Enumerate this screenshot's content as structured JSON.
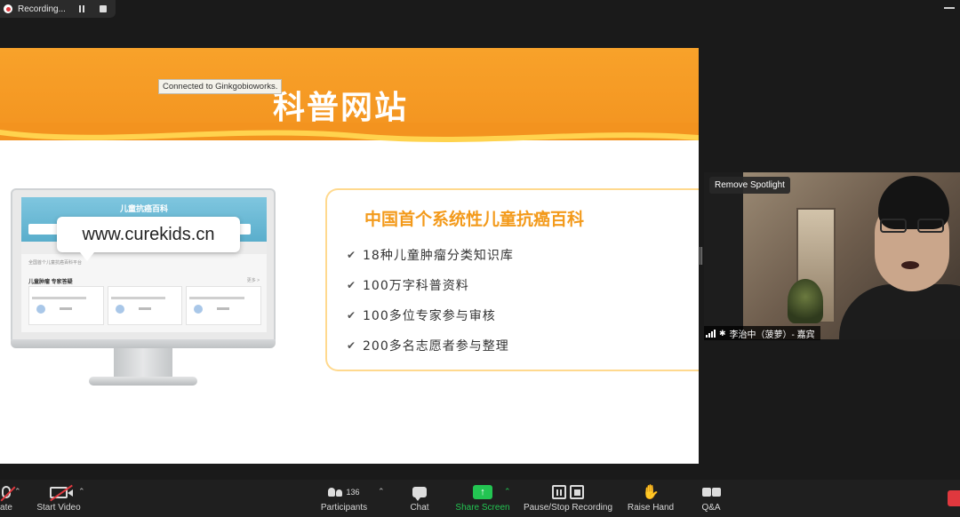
{
  "recording": {
    "label": "Recording..."
  },
  "slide": {
    "title": "科普网站",
    "tooltip": "Connected to Ginkgobioworks.",
    "monitor": {
      "site_title": "儿童抗癌百科",
      "url": "www.curekids.cn",
      "site_sub": "全国首个儿童抗癌百科平台",
      "section_title": "儿童肿瘤 专家答疑",
      "more": "更多 >"
    },
    "feature": {
      "title": "中国首个系统性儿童抗癌百科",
      "items": [
        "18种儿童肿瘤分类知识库",
        "100万字科普资料",
        "100多位专家参与审核",
        "200多名志愿者参与整理"
      ]
    }
  },
  "video": {
    "spotlight_label": "Remove Spotlight",
    "participant_name": "李治中（菠萝）- 嘉宾"
  },
  "toolbar": {
    "mute_label": "ate",
    "video_label": "Start Video",
    "participants_label": "Participants",
    "participants_count": "136",
    "chat_label": "Chat",
    "share_label": "Share Screen",
    "record_label": "Pause/Stop Recording",
    "raise_label": "Raise Hand",
    "qa_label": "Q&A"
  },
  "colors": {
    "banner_orange": "#f3931f",
    "feature_title": "#f39a1b",
    "share_green": "#23c552",
    "mute_red": "#e0383e"
  },
  "icons": [
    "record-icon",
    "pause-icon",
    "stop-icon",
    "mic-muted-icon",
    "video-off-icon",
    "participants-icon",
    "chat-icon",
    "share-screen-icon",
    "record-controls-icon",
    "raise-hand-icon",
    "qa-icon",
    "check-icon",
    "signal-icon",
    "pin-icon"
  ]
}
